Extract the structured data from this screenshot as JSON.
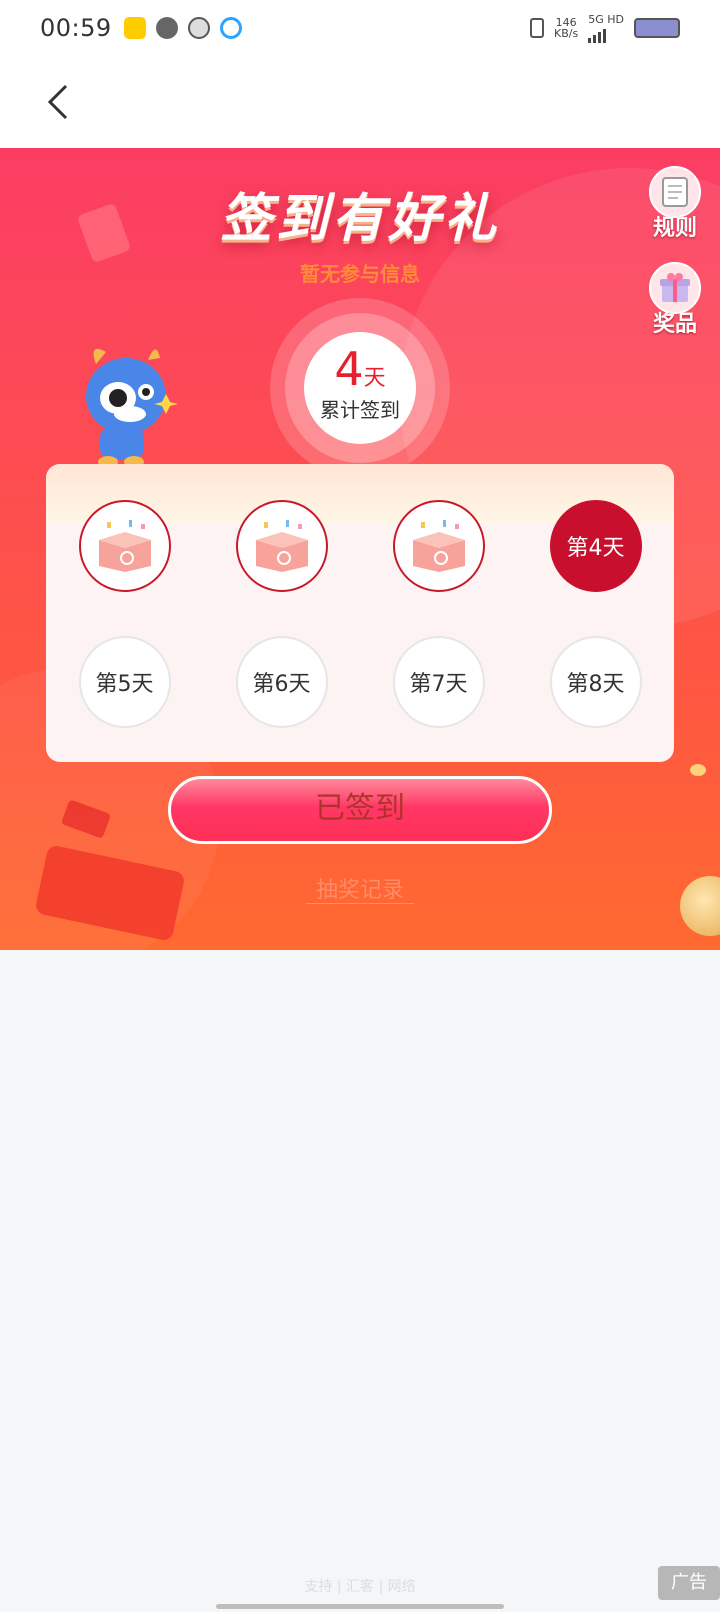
{
  "status_bar": {
    "time": "00:59",
    "net_speed": "146",
    "net_unit": "KB/s",
    "net_type": "5G HD",
    "icons": [
      "app-yellow-icon",
      "message-icon",
      "avatar-icon",
      "qq-browser-icon",
      "vibrate-icon",
      "signal-icon",
      "battery-icon"
    ]
  },
  "header": {
    "back_icon": "chevron-left-icon"
  },
  "banner": {
    "title": "签到有好礼",
    "subinfo": "暂无参与信息",
    "rules_label": "规则",
    "prizes_label": "奖品",
    "counter": {
      "number": "4",
      "unit": "天",
      "label": "累计签到"
    },
    "days": [
      {
        "label": "",
        "state": "done"
      },
      {
        "label": "",
        "state": "done"
      },
      {
        "label": "",
        "state": "done"
      },
      {
        "label": "第4天",
        "state": "today"
      },
      {
        "label": "第5天",
        "state": "pending"
      },
      {
        "label": "第6天",
        "state": "pending"
      },
      {
        "label": "第7天",
        "state": "pending"
      },
      {
        "label": "第8天",
        "state": "pending"
      }
    ],
    "signed_button": "已签到",
    "faint_link": "抽奖记录"
  },
  "footer": {
    "support": "支持 | 汇客 | 网络",
    "ad_label": "广告"
  },
  "colors": {
    "accent": "#c8102e",
    "banner_top": "#fb3d63",
    "banner_bottom": "#ff6a30"
  }
}
